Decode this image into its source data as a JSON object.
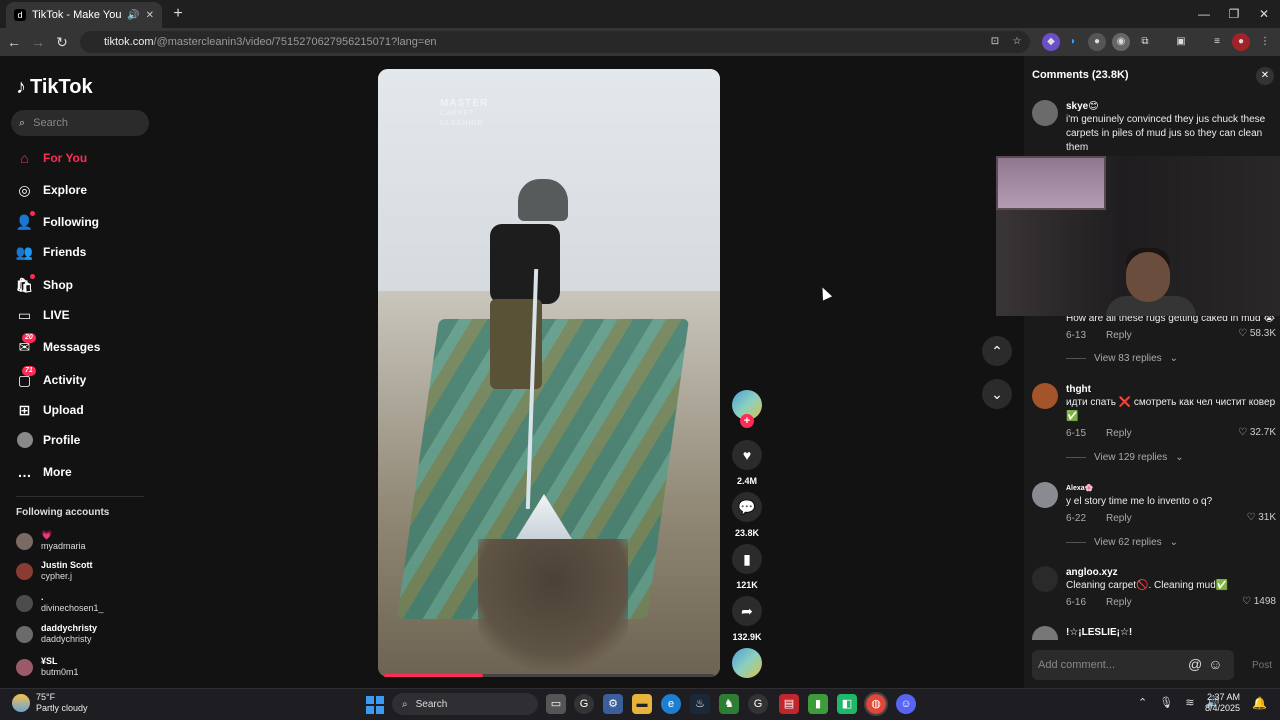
{
  "browser": {
    "tab_title": "TikTok - Make Your Day",
    "tab_favicon": "d",
    "url_host": "tiktok.com",
    "url_path": "/@mastercleanin3/video/7515270627956215071?lang=en"
  },
  "sidebar": {
    "logo_text": "TikTok",
    "search_placeholder": "Search",
    "nav": [
      {
        "label": "For You",
        "icon": "home-icon"
      },
      {
        "label": "Explore",
        "icon": "compass-icon"
      },
      {
        "label": "Following",
        "icon": "following-icon"
      },
      {
        "label": "Friends",
        "icon": "friends-icon"
      },
      {
        "label": "Shop",
        "icon": "shop-icon"
      },
      {
        "label": "LIVE",
        "icon": "live-icon"
      },
      {
        "label": "Messages",
        "icon": "messages-icon",
        "badge": "20"
      },
      {
        "label": "Activity",
        "icon": "activity-icon",
        "badge": "71"
      },
      {
        "label": "Upload",
        "icon": "upload-icon"
      },
      {
        "label": "Profile",
        "icon": "profile-icon"
      },
      {
        "label": "More",
        "icon": "more-icon"
      }
    ],
    "following_heading": "Following accounts",
    "accounts": [
      {
        "name": "💗",
        "handle": "myadmaria"
      },
      {
        "name": "Justin Scott",
        "handle": "cypher.j"
      },
      {
        "name": ".",
        "handle": "divinechosen1_"
      },
      {
        "name": "daddychristy",
        "handle": "daddychristy"
      },
      {
        "name": "¥SL",
        "handle": "butm0m1"
      }
    ]
  },
  "video": {
    "watermark_line1": "MASTER",
    "watermark_line2": "CARPET",
    "watermark_line3": "CLEANING",
    "progress_fraction": 0.3
  },
  "actions": {
    "likes": "2.4M",
    "comments": "23.8K",
    "bookmarks": "121K",
    "shares": "132.9K"
  },
  "comments_panel": {
    "title": "Comments (23.8K)",
    "items": [
      {
        "user": "skye😊",
        "text": "i'm genuinely convinced they jus chuck these carpets in piles of mud jus so they can clean them",
        "date": "",
        "likes": ""
      },
      {
        "user": "",
        "text": "How are all these rugs getting caked in mud 😭",
        "date": "6-13",
        "likes": "58.3K",
        "view_replies": "View 83 replies"
      },
      {
        "user": "thght",
        "text": "идти спать ❌ смотреть как чел чистит ковер ✅",
        "date": "6-15",
        "likes": "32.7K",
        "view_replies": "View 129 replies"
      },
      {
        "user": "Alexa🌸",
        "text": "y el story time me lo invento o q?",
        "date": "6-22",
        "likes": "31K",
        "view_replies": "View 62 replies"
      },
      {
        "user": "angloo.xyz",
        "text": "Cleaning carpet🚫. Cleaning mud✅",
        "date": "6-16",
        "likes": "1498"
      },
      {
        "user": "!☆¡LESLIE¡☆!",
        "text": "",
        "date": "",
        "likes": ""
      }
    ],
    "reply_label": "Reply",
    "input_placeholder": "Add comment...",
    "post_label": "Post"
  },
  "taskbar": {
    "weather_temp": "75°F",
    "weather_desc": "Partly cloudy",
    "search_label": "Search",
    "time": "2:37 AM",
    "date": "8/4/2025"
  }
}
